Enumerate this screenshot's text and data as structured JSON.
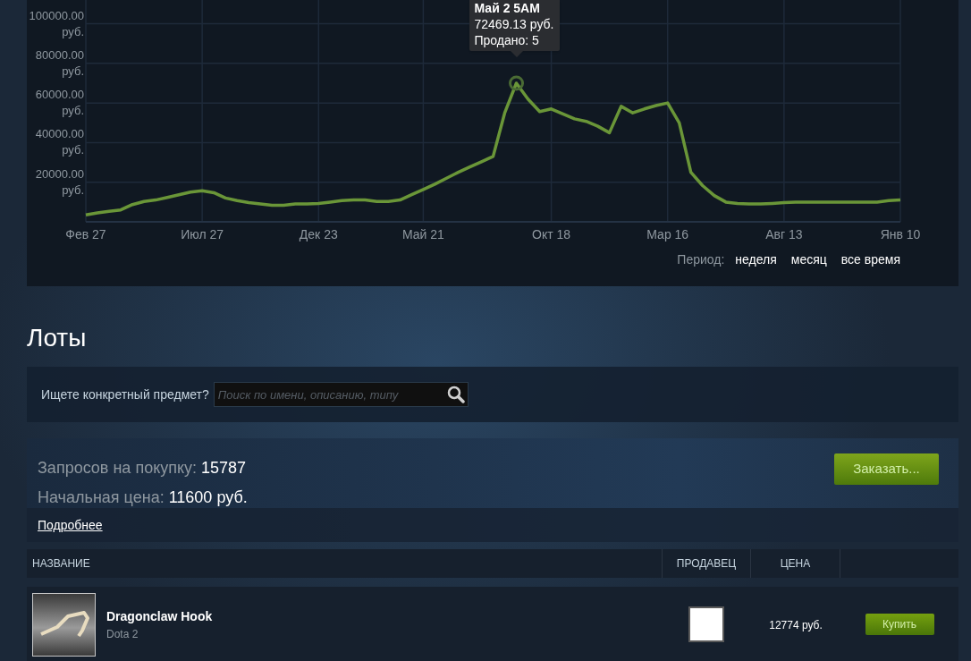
{
  "price_chart": {
    "tooltip": {
      "title": "Май 2 5AM",
      "price": "72469.13 руб.",
      "sold": "Продано: 5"
    },
    "chart_data": {
      "type": "line",
      "grid": true,
      "ylim": [
        0,
        112000
      ],
      "categories": [
        "Фев 27",
        null,
        null,
        null,
        null,
        null,
        null,
        null,
        null,
        null,
        "Июл 27",
        null,
        null,
        null,
        null,
        null,
        null,
        null,
        null,
        null,
        "Дек 23",
        null,
        null,
        null,
        null,
        null,
        null,
        null,
        null,
        "Май 21",
        null,
        null,
        null,
        null,
        null,
        null,
        null,
        null,
        null,
        null,
        "Окт 18",
        null,
        null,
        null,
        null,
        null,
        null,
        null,
        null,
        null,
        "Мар 16",
        null,
        null,
        null,
        null,
        null,
        null,
        null,
        null,
        null,
        "Авг 13",
        null,
        null,
        null,
        null,
        null,
        null,
        null,
        null,
        null,
        "Янв 10"
      ],
      "yticks": [
        {
          "value": 20000,
          "label": "20000.00 руб."
        },
        {
          "value": 40000,
          "label": "40000.00 руб."
        },
        {
          "value": 60000,
          "label": "60000.00 руб."
        },
        {
          "value": 80000,
          "label": "80000.00 руб."
        },
        {
          "value": 100000,
          "label": "100000.00 руб."
        }
      ],
      "series": [
        {
          "color": "#6a9638",
          "values": [
            3500,
            4500,
            5300,
            6000,
            8700,
            10300,
            11000,
            12300,
            13700,
            15000,
            15700,
            14700,
            12000,
            10700,
            9700,
            9000,
            8300,
            8300,
            9000,
            9000,
            9300,
            10000,
            10700,
            11000,
            11000,
            10300,
            10300,
            11000,
            13700,
            16300,
            19000,
            22000,
            25000,
            27700,
            30300,
            33000,
            55000,
            70000,
            62000,
            55700,
            57000,
            54500,
            52000,
            50700,
            48300,
            45000,
            58300,
            55000,
            57000,
            58700,
            60000,
            50000,
            25000,
            18300,
            13300,
            10000,
            9300,
            9000,
            9000,
            9300,
            9700,
            10000,
            10000,
            10000,
            10000,
            10000,
            10000,
            10000,
            10000,
            10700,
            11000
          ]
        }
      ]
    }
  },
  "period": {
    "label": "Период:",
    "options": [
      "неделя",
      "месяц",
      "все время"
    ]
  },
  "listings": {
    "title": "Лоты",
    "search": {
      "label": "Ищете конкретный предмет?",
      "placeholder": "Поиск по имени, описанию, типу"
    },
    "buy_orders": {
      "requests_label": "Запросов на покупку:",
      "requests": "15787",
      "start_price_label": "Начальная цена:",
      "start_price": "11600 руб.",
      "order_button": "Заказать...",
      "more_link": "Подробнее"
    },
    "table": {
      "columns": [
        "НАЗВАНИЕ",
        "ПРОДАВЕЦ",
        "ЦЕНА"
      ],
      "rows": [
        {
          "name": "Dragonclaw Hook",
          "game": "Dota 2",
          "price": "12774 руб.",
          "buy_button": "Купить"
        }
      ]
    }
  }
}
